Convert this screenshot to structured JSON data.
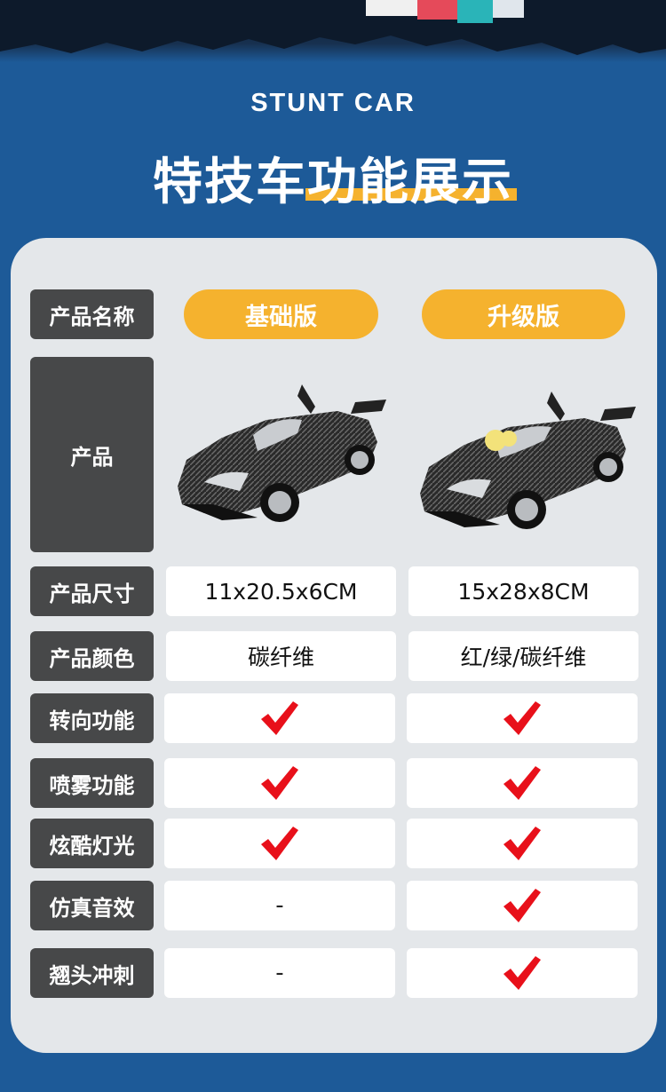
{
  "header": {
    "subtitle": "STUNT CAR",
    "title": "特技车功能展示"
  },
  "columns": {
    "basic": "基础版",
    "upgrade": "升级版"
  },
  "rows": [
    {
      "label": "产品名称"
    },
    {
      "label": "产品"
    },
    {
      "label": "产品尺寸",
      "basic": "11x20.5x6CM",
      "upgrade": "15x28x8CM"
    },
    {
      "label": "产品颜色",
      "basic": "碳纤维",
      "upgrade": "红/绿/碳纤维"
    },
    {
      "label": "转向功能",
      "basic": "check",
      "upgrade": "check"
    },
    {
      "label": "喷雾功能",
      "basic": "check",
      "upgrade": "check"
    },
    {
      "label": "炫酷灯光",
      "basic": "check",
      "upgrade": "check"
    },
    {
      "label": "仿真音效",
      "basic": "-",
      "upgrade": "check"
    },
    {
      "label": "翘头冲刺",
      "basic": "-",
      "upgrade": "check"
    }
  ],
  "colors": {
    "background": "#1d5a98",
    "accent": "#f5b22e",
    "label_bg": "#474849",
    "panel_bg": "#e4e7ea",
    "check": "#e8101a"
  },
  "icons": {
    "check": "checkmark-icon"
  }
}
